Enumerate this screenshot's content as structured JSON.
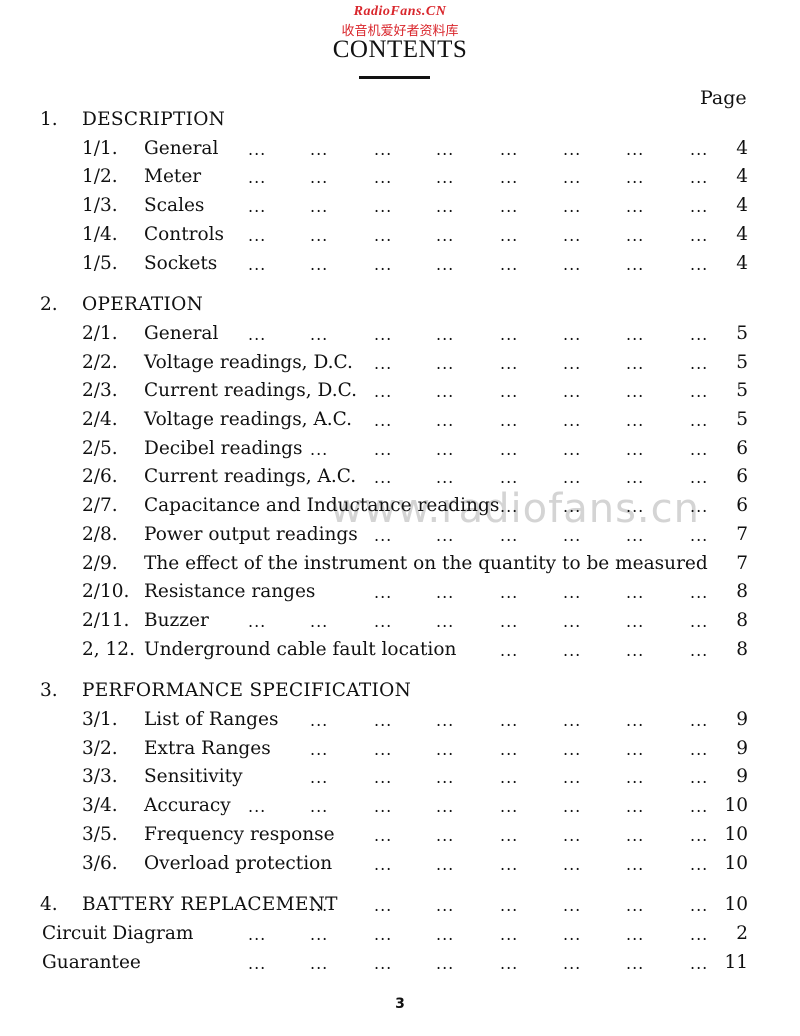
{
  "watermark": {
    "site": "RadioFans.CN",
    "subtitle": "收音机爱好者资料库",
    "center": "www.radiofans.cn"
  },
  "title": "CONTENTS",
  "page_column_header": "Page",
  "sections": [
    {
      "number": "1.",
      "title": "DESCRIPTION",
      "entries": [
        {
          "number": "1/1.",
          "title": "General",
          "page": "4"
        },
        {
          "number": "1/2.",
          "title": "Meter",
          "page": "4"
        },
        {
          "number": "1/3.",
          "title": "Scales",
          "page": "4"
        },
        {
          "number": "1/4.",
          "title": "Controls",
          "page": "4"
        },
        {
          "number": "1/5.",
          "title": "Sockets",
          "page": "4"
        }
      ]
    },
    {
      "number": "2.",
      "title": "OPERATION",
      "entries": [
        {
          "number": "2/1.",
          "title": "General",
          "page": "5"
        },
        {
          "number": "2/2.",
          "title": "Voltage readings, D.C.",
          "page": "5"
        },
        {
          "number": "2/3.",
          "title": "Current readings, D.C.",
          "page": "5"
        },
        {
          "number": "2/4.",
          "title": "Voltage readings, A.C.",
          "page": "5"
        },
        {
          "number": "2/5.",
          "title": "Decibel readings",
          "page": "6"
        },
        {
          "number": "2/6.",
          "title": "Current readings, A.C.",
          "page": "6"
        },
        {
          "number": "2/7.",
          "title": "Capacitance and Inductance readings",
          "page": "6"
        },
        {
          "number": "2/8.",
          "title": "Power output readings",
          "page": "7"
        },
        {
          "number": "2/9.",
          "title": "The effect of the instrument on the quantity to be measured",
          "page": "7"
        },
        {
          "number": "2/10.",
          "title": "Resistance ranges",
          "page": "8"
        },
        {
          "number": "2/11.",
          "title": "Buzzer",
          "page": "8"
        },
        {
          "number": "2, 12.",
          "title": "Underground cable fault location",
          "page": "8"
        }
      ]
    },
    {
      "number": "3.",
      "title": "PERFORMANCE  SPECIFICATION",
      "entries": [
        {
          "number": "3/1.",
          "title": "List of Ranges",
          "page": "9"
        },
        {
          "number": "3/2.",
          "title": "Extra Ranges",
          "page": "9"
        },
        {
          "number": "3/3.",
          "title": "Sensitivity",
          "page": "9"
        },
        {
          "number": "3/4.",
          "title": "Accuracy",
          "page": "10"
        },
        {
          "number": "3/5.",
          "title": "Frequency response",
          "page": "10"
        },
        {
          "number": "3/6.",
          "title": "Overload protection",
          "page": "10"
        }
      ]
    },
    {
      "number": "4.",
      "title": "BATTERY  REPLACEMENT",
      "page": "10",
      "entries": []
    }
  ],
  "extras": [
    {
      "title": "Circuit Diagram",
      "page": "2"
    },
    {
      "title": "Guarantee",
      "page": "11"
    }
  ],
  "leader": "...",
  "page_number": "3"
}
